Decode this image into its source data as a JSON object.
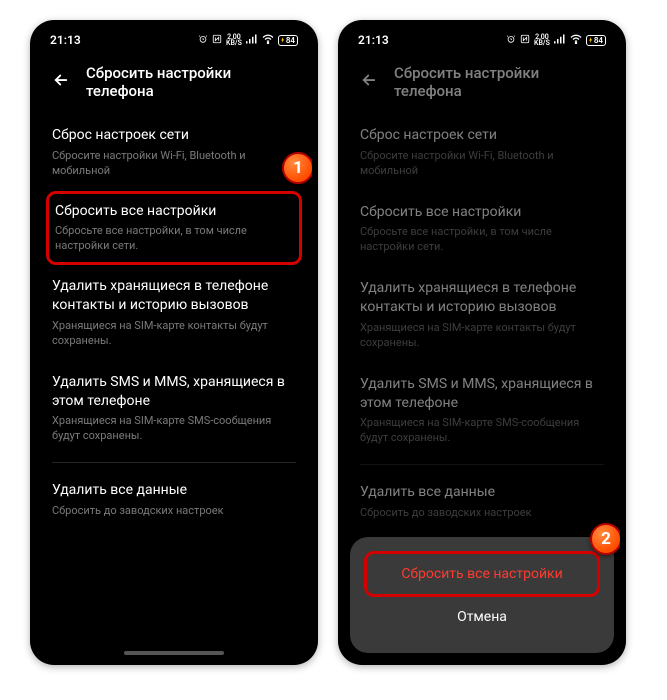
{
  "status": {
    "time": "21:13",
    "speed_val": "2,00",
    "speed_unit": "KB/S",
    "battery": "84"
  },
  "header": {
    "title": "Сбросить настройки телефона"
  },
  "items": [
    {
      "title": "Сброс настроек сети",
      "sub": "Сбросите настройки Wi-Fi, Bluetooth и мобильной",
      "highlighted": false
    },
    {
      "title": "Сбросить все настройки",
      "sub": "Сбросьте все настройки, в том числе настройки сети.",
      "highlighted": true
    },
    {
      "title": "Удалить хранящиеся в телефоне контакты и историю вызовов",
      "sub": "Хранящиеся на SIM-карте контакты будут сохранены.",
      "highlighted": false
    },
    {
      "title": "Удалить SMS и MMS, хранящиеся в этом телефоне",
      "sub": "Хранящиеся на SIM-карте SMS-сообщения будут сохранены.",
      "highlighted": false
    },
    {
      "title": "Удалить все данные",
      "sub": "Сбросить до заводских настроек",
      "highlighted": false,
      "divider_before": true
    }
  ],
  "sheet": {
    "confirm": "Сбросить все настройки",
    "cancel": "Отмена"
  },
  "callouts": {
    "one": "1",
    "two": "2"
  }
}
